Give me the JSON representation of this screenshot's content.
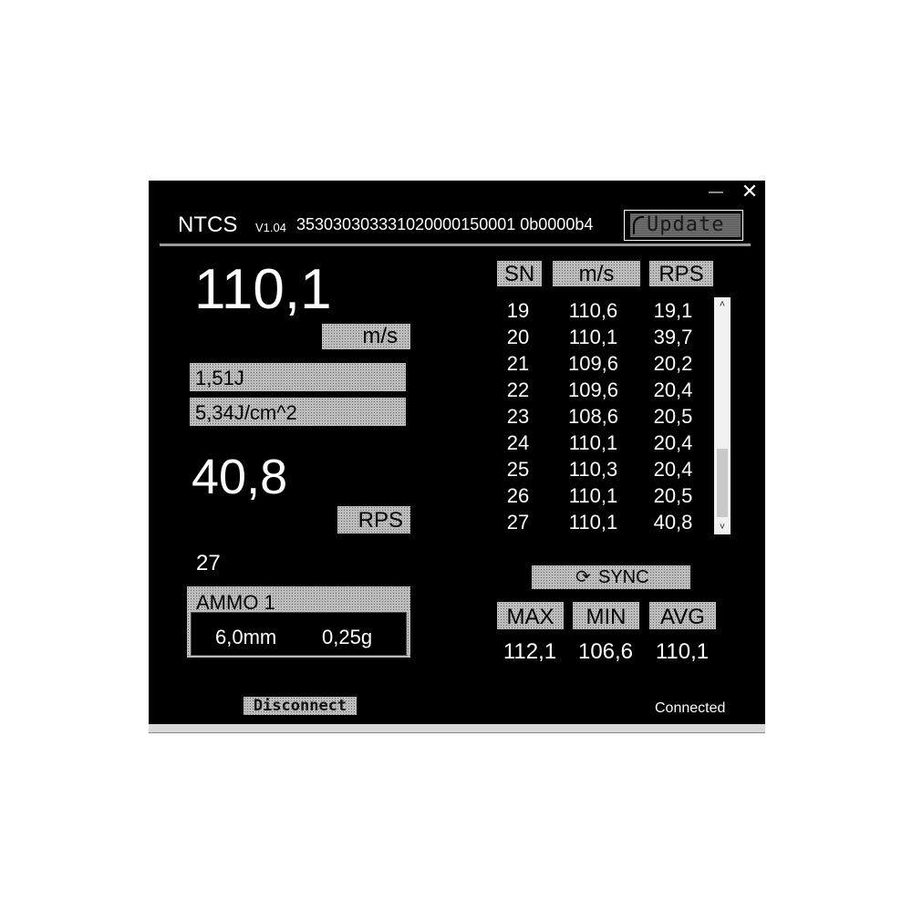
{
  "window": {
    "minimize_glyph": "—",
    "close_glyph": "✕"
  },
  "header": {
    "title": "NTCS",
    "version": "V1.04",
    "serial": "353030303331020000150001 0b0000b4",
    "update_label": "Update"
  },
  "main": {
    "velocity": "110,1",
    "velocity_unit": "m/s",
    "energy": "1,51J",
    "energy_density": "5,34J/cm^2",
    "rate": "40,8",
    "rate_unit": "RPS",
    "shot_count": "27"
  },
  "ammo": {
    "title": "AMMO 1",
    "caliber": "6,0mm",
    "weight": "0,25g"
  },
  "table": {
    "headers": [
      "SN",
      "m/s",
      "RPS"
    ],
    "rows": [
      [
        "19",
        "110,6",
        "19,1"
      ],
      [
        "20",
        "110,1",
        "39,7"
      ],
      [
        "21",
        "109,6",
        "20,2"
      ],
      [
        "22",
        "109,6",
        "20,4"
      ],
      [
        "23",
        "108,6",
        "20,5"
      ],
      [
        "24",
        "110,1",
        "20,4"
      ],
      [
        "25",
        "110,3",
        "20,4"
      ],
      [
        "26",
        "110,1",
        "20,5"
      ],
      [
        "27",
        "110,1",
        "40,8"
      ]
    ],
    "scroll_up": "˄",
    "scroll_down": "˅"
  },
  "sync": {
    "label": "SYNC",
    "icon": "refresh-icon"
  },
  "stats": {
    "max_label": "MAX",
    "min_label": "MIN",
    "avg_label": "AVG",
    "max": "112,1",
    "min": "106,6",
    "avg": "110,1"
  },
  "footer": {
    "disconnect_label": "Disconnect",
    "status": "Connected"
  },
  "colors": {
    "background": "#000000",
    "text": "#ffffff",
    "label_gray": "#bcbcbc"
  }
}
